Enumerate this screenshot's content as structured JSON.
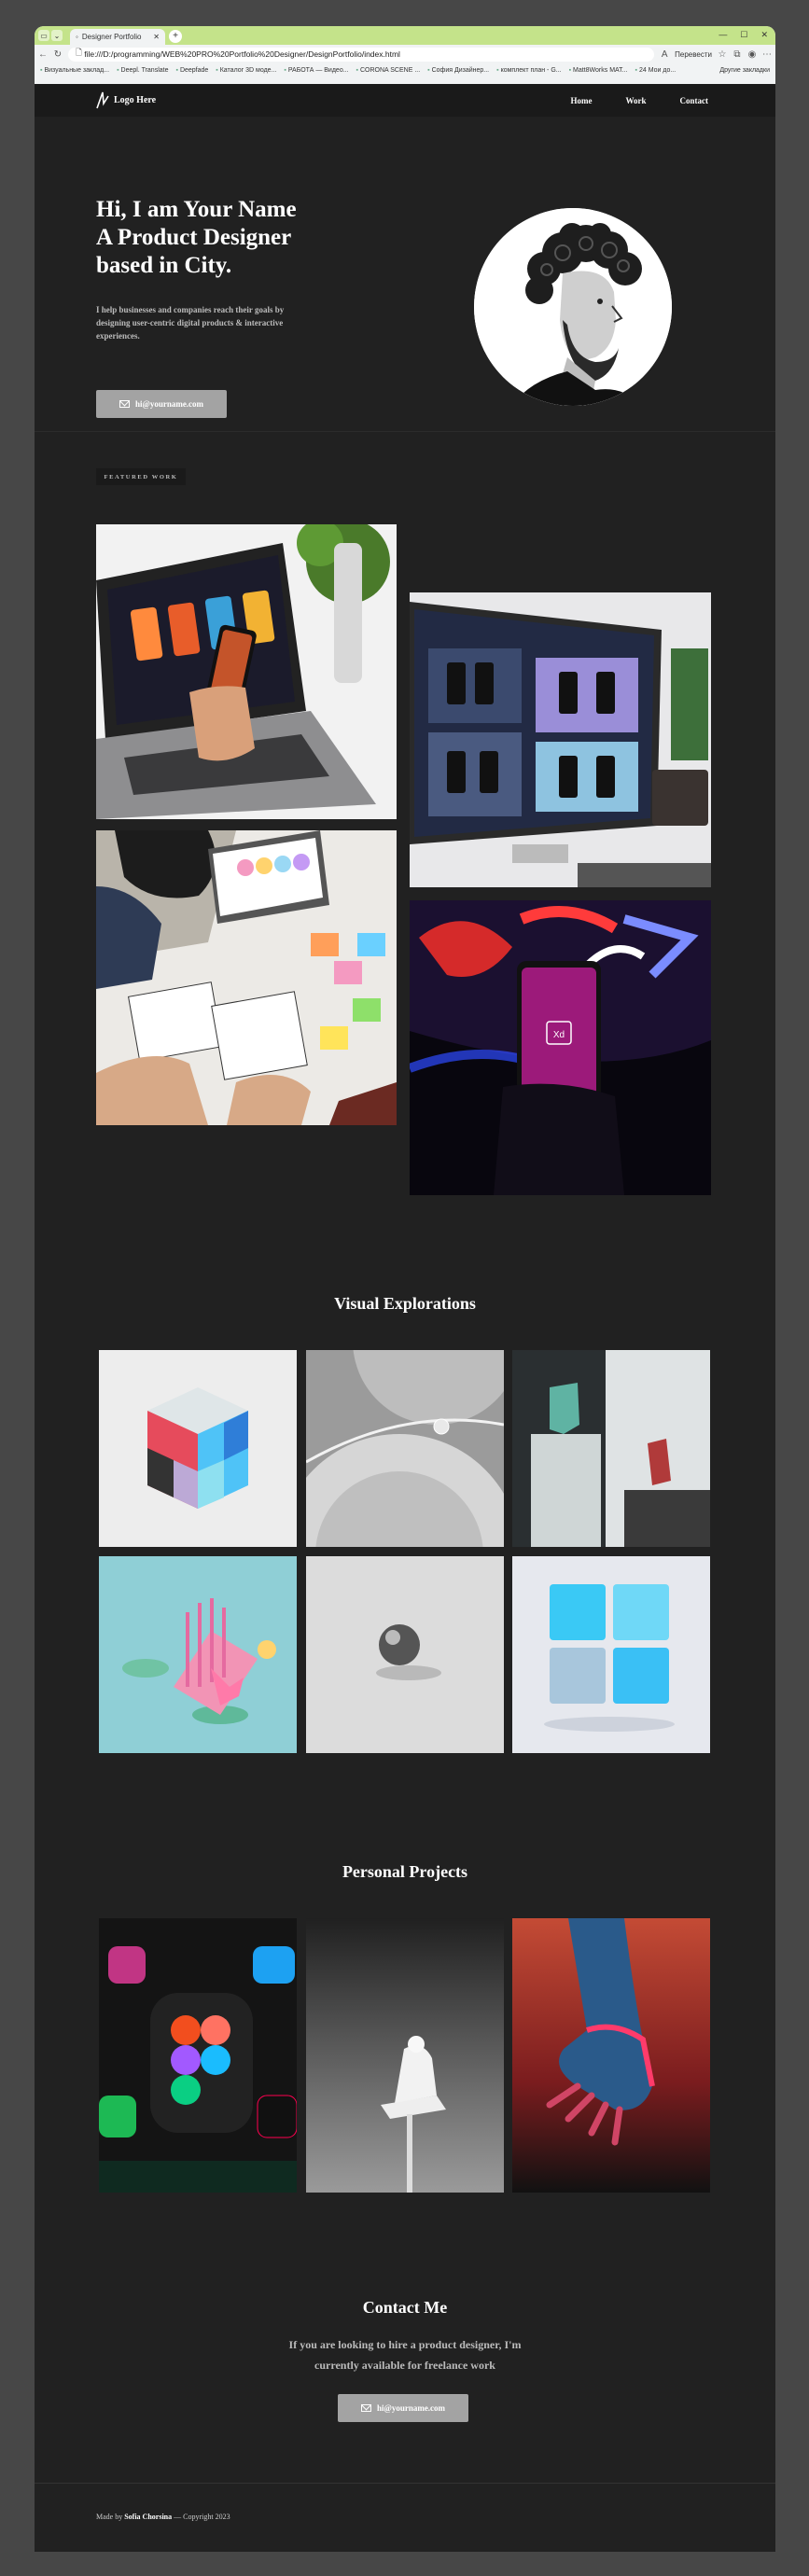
{
  "browser": {
    "tab_title": "Designer Portfolio",
    "url": "file:///D:/programming/WEB%20PRO%20Portfolio%20Designer/DesignPortfolio/index.html",
    "translate_label": "Перевести",
    "bookmarks": [
      "Визуальные заклад...",
      "Deepl. Translate",
      "Deepfade",
      "Каталог 3D моде...",
      "РАБОТА — Видео...",
      "CORONA SCENE ...",
      "София Дизайнер...",
      "комплект план - G...",
      "Matt8Works MAT...",
      "24 Мои до..."
    ],
    "other_bookmarks": "Другие закладки"
  },
  "nav": {
    "logo_text": "Logo Here",
    "links": [
      "Home",
      "Work",
      "Contact"
    ]
  },
  "hero": {
    "title_lines": [
      "Hi, I am Your Name",
      "A Product Designer",
      "based in City."
    ],
    "subtitle": "I help businesses and companies reach their goals by designing user-centric digital products & interactive experiences.",
    "button_label": "hi@yourname.com"
  },
  "featured": {
    "label": "FEATURED WORK"
  },
  "visual": {
    "title": "Visual Explorations"
  },
  "personal": {
    "title": "Personal Projects"
  },
  "contact": {
    "title": "Contact Me",
    "text": "If you are looking to hire a product designer, I'm currently available for freelance work",
    "button_label": "hi@yourname.com"
  },
  "footer": {
    "prefix": "Made by",
    "author": "Sofia Chorsina",
    "suffix": "— Copyright 2023"
  },
  "colors": {
    "background": "#212121",
    "nav": "#1a1a1a",
    "button": "#a3a3a3",
    "tab_bar": "#c4e38a"
  }
}
